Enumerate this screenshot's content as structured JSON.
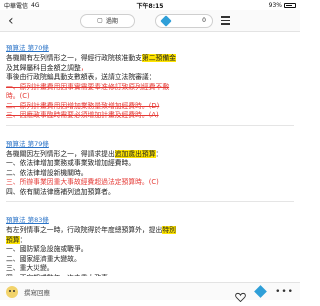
{
  "status_bar": {
    "carrier": "中華電信",
    "network": "4G",
    "time": "下午8:15",
    "battery": "93%"
  },
  "top_bar": {
    "middle_label": "過期",
    "count_value": "0"
  },
  "blocks": [
    {
      "ref": "預算法 第70條",
      "lines": [
        {
          "segments": [
            {
              "t": "各機關有左列情形之一，得經行政院核准動支"
            },
            {
              "t": "第二預備金",
              "hl": true
            }
          ]
        },
        {
          "segments": [
            {
              "t": "及其歸屬科目金額之調整"
            },
            {
              "t": "，",
              "red": true
            }
          ]
        },
        {
          "segments": [
            {
              "t": "事後由行政院編具動支數額表，送請立法院審議："
            }
          ]
        },
        {
          "segments": [
            {
              "t": "一、原列計畫費用因事實需要奉准修訂致原列經費不敷",
              "red": true,
              "strike": true
            }
          ]
        },
        {
          "segments": [
            {
              "t": "時。(C)",
              "red": true
            }
          ]
        },
        {
          "segments": [
            {
              "t": "二、原列計畫費用因增加業務量致增加經費時。(D)",
              "red": true,
              "strike": true
            }
          ]
        },
        {
          "segments": [
            {
              "t": "三、因應政事臨時需要必須增加計畫及經費時。(A)",
              "red": true,
              "strike": true
            }
          ]
        }
      ]
    },
    {
      "ref": "預算法 第79條",
      "lines": [
        {
          "segments": [
            {
              "t": "各機關因左列情形之一，得請求提出"
            },
            {
              "t": "追加歲出預算",
              "hl": true
            },
            {
              "t": "："
            }
          ]
        },
        {
          "segments": [
            {
              "t": "一、依法律增加業務或事業致增加經費時。"
            }
          ]
        },
        {
          "segments": [
            {
              "t": "二、依法律增設新機關時。"
            }
          ]
        },
        {
          "segments": [
            {
              "t": "三、所辦事業因重大事故經費超過法定預算時。(C)",
              "red": true
            }
          ]
        },
        {
          "segments": [
            {
              "t": "四、依有關法律應補列追加預算者。"
            }
          ]
        }
      ]
    },
    {
      "ref": "預算法 第83條",
      "lines": [
        {
          "segments": [
            {
              "t": "有左列情事之一時，行政院得於年度總預算外，提出"
            },
            {
              "t": "特別",
              "hl": true
            }
          ]
        },
        {
          "segments": [
            {
              "t": "預算",
              "hl": true
            },
            {
              "t": "："
            }
          ]
        },
        {
          "segments": [
            {
              "t": "一、國防緊急設施或戰爭。"
            }
          ]
        },
        {
          "segments": [
            {
              "t": "二、國家經濟重大變故。"
            }
          ]
        },
        {
          "segments": [
            {
              "t": "三、重大災變。"
            }
          ]
        },
        {
          "segments": [
            {
              "t": "四、不定期或數年一次之重大政事。"
            }
          ]
        }
      ]
    }
  ],
  "bottom_bar": {
    "reply_label": "撰寫回應",
    "more": "•••"
  },
  "colors": {
    "accent": "#2f9fd8",
    "link": "#2a73c7",
    "annotation_red": "#e53935",
    "highlight": "#ffe500"
  }
}
